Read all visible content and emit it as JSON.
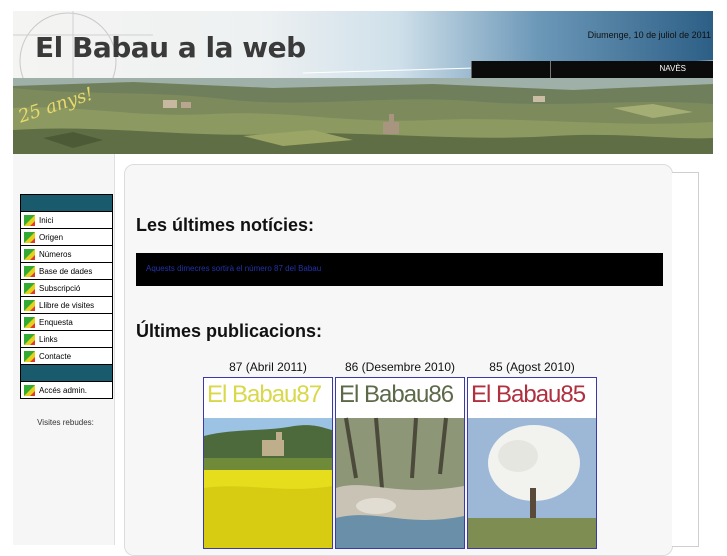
{
  "header": {
    "site_title": "El Babau a la web",
    "date": "Diumenge, 10 de juliol de 2011",
    "nav_item": "NAVÈS",
    "anniversary_stamp": "25 anys!"
  },
  "sidebar": {
    "items": [
      {
        "label": "Inici",
        "icon": "menu-bullet-icon"
      },
      {
        "label": "Origen",
        "icon": "menu-bullet-icon"
      },
      {
        "label": "Números",
        "icon": "menu-bullet-icon"
      },
      {
        "label": "Base de dades",
        "icon": "menu-bullet-icon"
      },
      {
        "label": "Subscripció",
        "icon": "menu-bullet-icon"
      },
      {
        "label": "Llibre de visites",
        "icon": "menu-bullet-icon"
      },
      {
        "label": "Enquesta",
        "icon": "menu-bullet-icon"
      },
      {
        "label": "Links",
        "icon": "menu-bullet-icon"
      },
      {
        "label": "Contacte",
        "icon": "menu-bullet-icon"
      }
    ],
    "admin_item": {
      "label": "Accés admin.",
      "icon": "menu-bullet-icon"
    },
    "visits_label": "Visites rebudes:"
  },
  "main": {
    "news_heading": "Les últimes notícies:",
    "news_link": "Aquests dimecres sortirà el número 87 del Babau",
    "publications_heading": "Últimes publicacions:",
    "publications": [
      {
        "caption": "87 (Abril 2011)",
        "masthead": "El Babau87",
        "masthead_color": "#d8d84a"
      },
      {
        "caption": "86 (Desembre 2010)",
        "masthead": "El Babau86",
        "masthead_color": "#5d6a4a"
      },
      {
        "caption": "85 (Agost 2010)",
        "masthead": "El Babau85",
        "masthead_color": "#b03040"
      }
    ]
  },
  "colors": {
    "menu_header": "#1a5a6d",
    "news_bar": "#000000",
    "news_link": "#2233aa",
    "cover_border": "#3a3aa8"
  }
}
